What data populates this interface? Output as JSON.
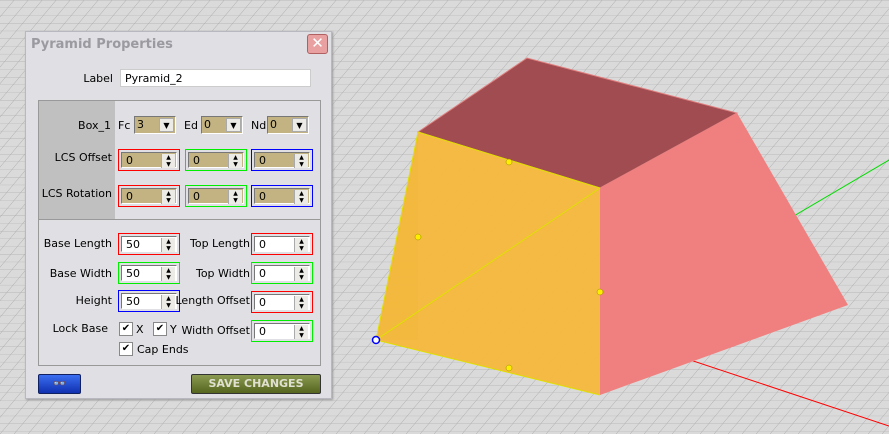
{
  "dialog": {
    "title": "Pyramid Properties",
    "label_caption": "Label",
    "label_value": "Pyramid_2",
    "box": {
      "name": "Box_1",
      "fc_label": "Fc",
      "fc_value": "3",
      "ed_label": "Ed",
      "ed_value": "0",
      "nd_label": "Nd",
      "nd_value": "0"
    },
    "lcs_offset": {
      "label": "LCS Offset",
      "x": "0",
      "y": "0",
      "z": "0"
    },
    "lcs_rotation": {
      "label": "LCS Rotation",
      "x": "0",
      "y": "0",
      "z": "0"
    },
    "base_length": {
      "label": "Base Length",
      "value": "50"
    },
    "base_width": {
      "label": "Base Width",
      "value": "50"
    },
    "height": {
      "label": "Height",
      "value": "50"
    },
    "top_length": {
      "label": "Top Length",
      "value": "0"
    },
    "top_width": {
      "label": "Top Width",
      "value": "0"
    },
    "length_offset": {
      "label": "Length Offset",
      "value": "0"
    },
    "width_offset": {
      "label": "Width Offset",
      "value": "0"
    },
    "lock_base": {
      "label": "Lock Base",
      "x_label": "X",
      "y_label": "Y",
      "x_checked": true,
      "y_checked": true
    },
    "cap_ends": {
      "label": "Cap Ends",
      "checked": true
    },
    "save_label": "SAVE CHANGES",
    "view_icon": "glasses-icon"
  },
  "colors": {
    "x_axis": "#ff0000",
    "y_axis": "#00ee00",
    "z_axis": "#0000ff",
    "face_top": "#a04c50",
    "face_front": "#f5b83c",
    "face_side": "#f08080"
  }
}
